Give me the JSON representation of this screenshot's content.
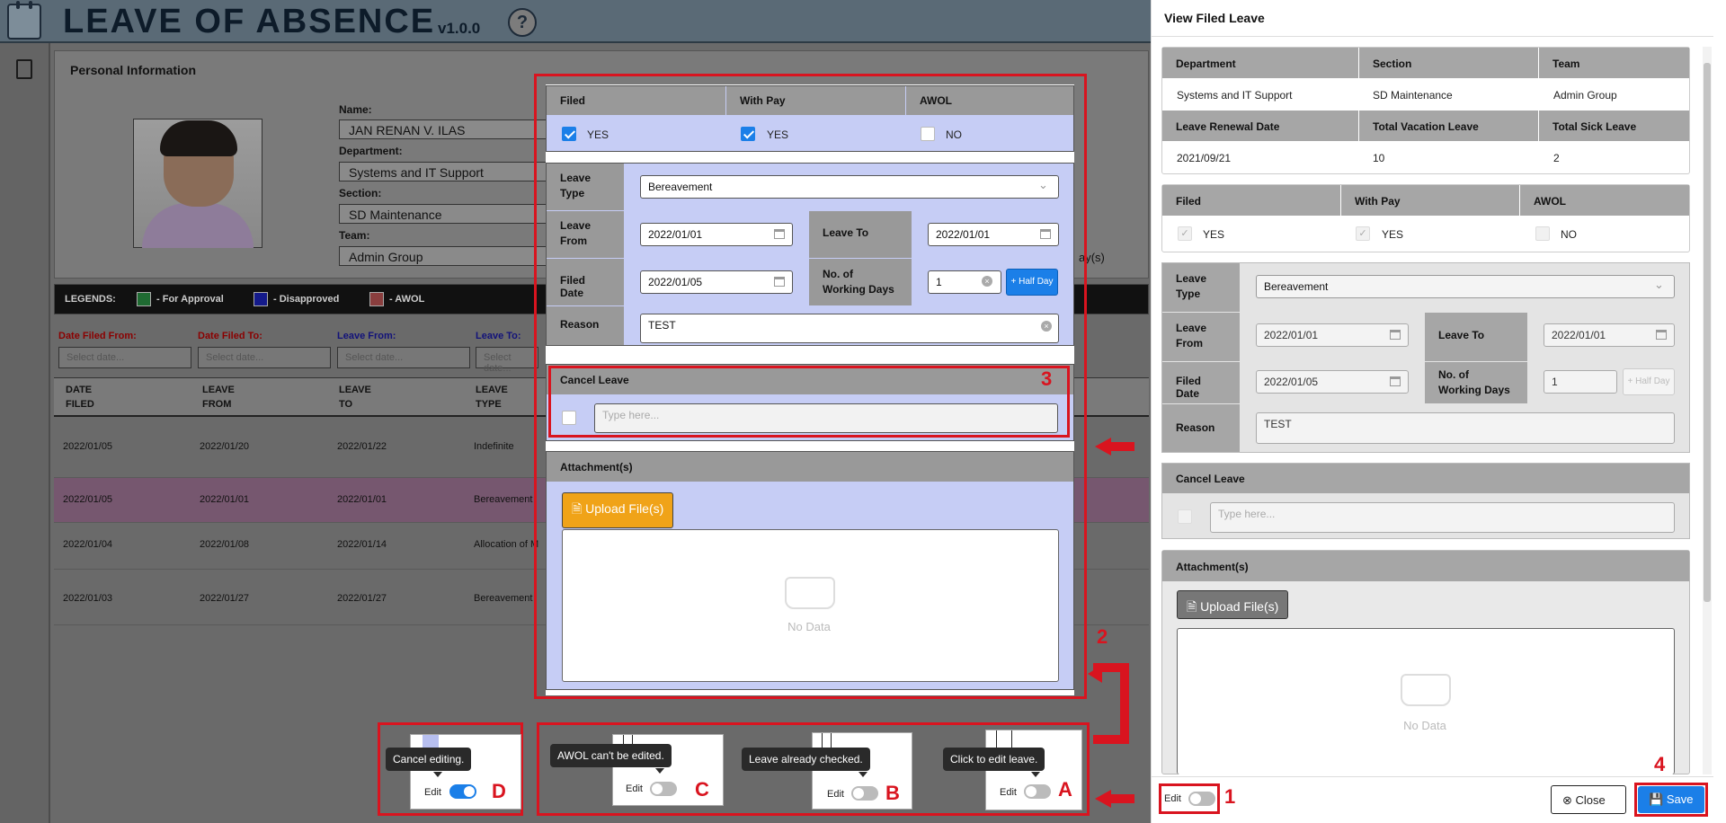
{
  "app": {
    "title": "LEAVE OF ABSENCE",
    "version": "v1.0.0",
    "help": "?"
  },
  "personal": {
    "title": "Personal Information",
    "name_label": "Name:",
    "name": "JAN RENAN V. ILAS",
    "department_label": "Department:",
    "department": "Systems and IT Support",
    "section_label": "Section:",
    "section": "SD Maintenance",
    "team_label": "Team:",
    "team": "Admin Group",
    "extra": "ay(s)"
  },
  "legends": {
    "label": "LEGENDS:",
    "items": [
      {
        "label": "- For Approval",
        "color": "#1f6b32"
      },
      {
        "label": "- Disapproved",
        "color": "#141a8a"
      },
      {
        "label": "- AWOL",
        "color": "#8a3e3e"
      }
    ]
  },
  "filters": [
    {
      "label": "Date Filed From:",
      "color": "#8b0000",
      "placeholder": "Select date..."
    },
    {
      "label": "Date Filed To:",
      "color": "#8b0000",
      "placeholder": "Select date..."
    },
    {
      "label": "Leave From:",
      "color": "#12127a",
      "placeholder": "Select date..."
    },
    {
      "label": "Leave To:",
      "color": "#12127a",
      "placeholder": "Select date..."
    }
  ],
  "table": {
    "headers": [
      [
        "DATE",
        "FILED"
      ],
      [
        "LEAVE",
        "FROM"
      ],
      [
        "LEAVE",
        "TO"
      ],
      [
        "LEAVE",
        "TYPE"
      ]
    ],
    "rows": [
      [
        "2022/01/05",
        "2022/01/20",
        "2022/01/22",
        "Indefinite"
      ],
      [
        "2022/01/05",
        "2022/01/01",
        "2022/01/01",
        "Bereavement"
      ],
      [
        "2022/01/04",
        "2022/01/08",
        "2022/01/14",
        "Allocation of M"
      ],
      [
        "2022/01/03",
        "2022/01/27",
        "2022/01/27",
        "Bereavement"
      ]
    ]
  },
  "form": {
    "filed": {
      "label": "Filed",
      "value": "YES"
    },
    "with_pay": {
      "label": "With Pay",
      "value": "YES"
    },
    "awol": {
      "label": "AWOL",
      "value": "NO"
    },
    "leave_type_label": "Leave Type",
    "leave_type": "Bereavement",
    "leave_from_label": "Leave From",
    "leave_from": "2022/01/01",
    "leave_to_label": "Leave To",
    "leave_to": "2022/01/01",
    "filed_date_label": "Filed Date",
    "filed_date": "2022/01/05",
    "working_days_label": "No. of Working Days",
    "working_days": "1",
    "half_day": "+ Half Day",
    "reason_label": "Reason",
    "reason": "TEST",
    "cancel_label": "Cancel Leave",
    "cancel_placeholder": "Type here...",
    "attach_label": "Attachment(s)",
    "upload": "Upload File(s)",
    "no_data": "No Data"
  },
  "drawer": {
    "title": "View Filed Leave",
    "info_headers": [
      "Department",
      "Section",
      "Team"
    ],
    "info_values": [
      "Systems and IT Support",
      "SD Maintenance",
      "Admin Group"
    ],
    "info_headers2": [
      "Leave Renewal Date",
      "Total Vacation Leave",
      "Total Sick Leave"
    ],
    "info_values2": [
      "2021/09/21",
      "10",
      "2"
    ],
    "edit_label": "Edit",
    "close": "Close",
    "save": "Save"
  },
  "annotations": {
    "m1": "1",
    "m2": "2",
    "m3": "3",
    "m4": "4",
    "A": "A",
    "B": "B",
    "C": "C",
    "D": "D",
    "tipA": "Click to edit leave.",
    "tipB": "Leave already checked.",
    "tipC": "AWOL can't be edited.",
    "tipD": "Cancel editing.",
    "edit": "Edit"
  }
}
